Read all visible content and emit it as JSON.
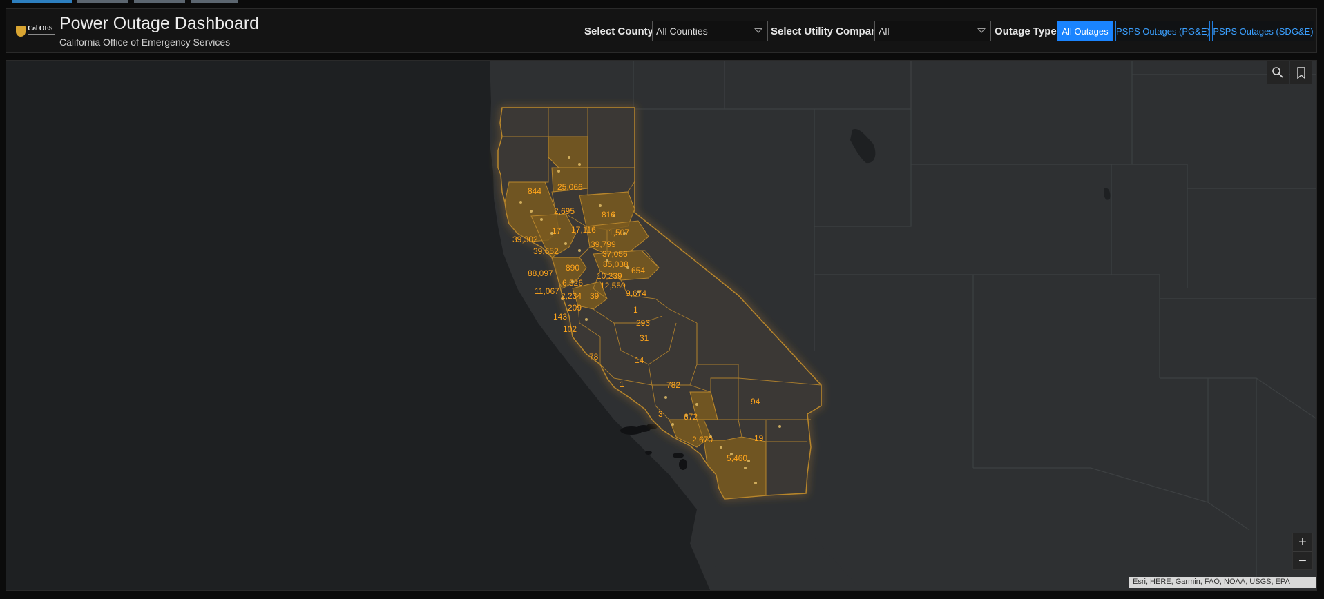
{
  "app": {
    "title": "Power Outage Dashboard",
    "subtitle": "California Office of Emergency Services",
    "logo_text": "Cal OES"
  },
  "filters": {
    "county_label": "Select County:",
    "county_value": "All Counties",
    "utility_label": "Select Utility Company",
    "utility_value": "All",
    "outage_type_label": "Outage Type:",
    "outage_types": [
      {
        "label": "All Outages",
        "active": true
      },
      {
        "label": "PSPS Outages (PG&E)",
        "active": false
      },
      {
        "label": "PSPS Outages (SDG&E)",
        "active": false
      }
    ]
  },
  "map": {
    "controls": {
      "search_icon": "search-icon",
      "bookmark_icon": "bookmark-icon",
      "zoom_in": "+",
      "zoom_out": "−"
    },
    "attribution": "Esri, HERE, Garmin, FAO, NOAA, USGS, EPA",
    "county_labels": [
      "25,066",
      "844",
      "2,695",
      "816",
      "17",
      "17,116",
      "1,507",
      "39,302",
      "39,799",
      "39,652",
      "37,056",
      "85,038",
      "890",
      "654",
      "88,097",
      "10,239",
      "6,526",
      "12,550",
      "11,067",
      "9,674",
      "2,234",
      "39",
      "209",
      "1",
      "143",
      "293",
      "102",
      "31",
      "78",
      "14",
      "1",
      "782",
      "94",
      "3",
      "672",
      "19",
      "2,670",
      "5,460"
    ],
    "colors": {
      "county_fill": "#7a5a1e",
      "county_stroke": "#b8862c",
      "label": "#ffa51c",
      "water": "#1e2022",
      "land": "#2d2f31"
    }
  }
}
